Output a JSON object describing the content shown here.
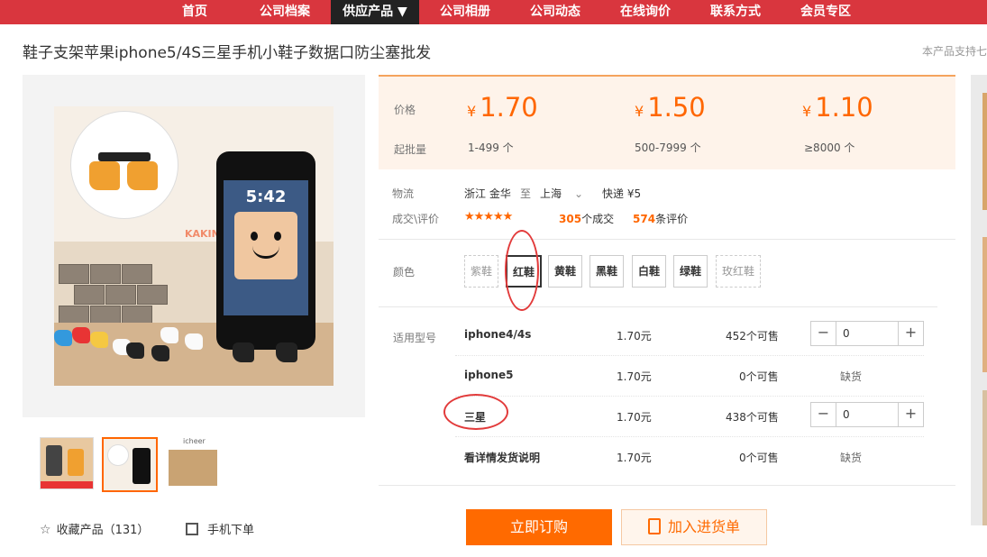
{
  "nav": {
    "items": [
      "首页",
      "公司档案",
      "供应产品 ▼",
      "公司相册",
      "公司动态",
      "在线询价",
      "联系方式",
      "会员专区"
    ],
    "active_index": 2,
    "color": "#d9363e"
  },
  "product": {
    "title": "鞋子支架苹果iphone5/4S三星手机小鞋子数据口防尘塞批发",
    "support_note": "本产品支持七"
  },
  "gallery": {
    "watermark": "KAKING",
    "phone_time": "5:42",
    "thumbnails": [
      "thumb-1",
      "thumb-2",
      "thumb-3"
    ],
    "active_thumb": 1,
    "thumb3_caption": "icheer",
    "favorite_label": "收藏产品（131）",
    "mobile_label": "手机下单"
  },
  "pricing": {
    "price_label": "价格",
    "moq_label": "起批量",
    "currency": "¥",
    "tiers": [
      {
        "price": "1.70",
        "qty": "1-499 个"
      },
      {
        "price": "1.50",
        "qty": "500-7999 个"
      },
      {
        "price": "1.10",
        "qty": "≥8000 个"
      }
    ],
    "accent": "#ff6600"
  },
  "logistics": {
    "label": "物流",
    "from": "浙江 金华",
    "to_word": "至",
    "dest": "上海",
    "ship": "快递 ¥5"
  },
  "reviews": {
    "label": "成交\\评价",
    "stars": "★★★★★",
    "deals_count": "305",
    "deals_unit": "个成交",
    "reviews_count": "574",
    "reviews_unit": "条评价",
    "rating": 4.5
  },
  "colors": {
    "label": "颜色",
    "options": [
      "紫鞋",
      "红鞋",
      "黄鞋",
      "黑鞋",
      "白鞋",
      "绿鞋",
      "玫红鞋"
    ],
    "selected_index": 1
  },
  "models": {
    "label": "适用型号",
    "rows": [
      {
        "name": "iphone4/4s",
        "price": "1.70元",
        "stock": "452个可售",
        "qty": "0",
        "status": ""
      },
      {
        "name": "iphone5",
        "price": "1.70元",
        "stock": "0个可售",
        "qty": "",
        "status": "缺货"
      },
      {
        "name": "三星",
        "price": "1.70元",
        "stock": "438个可售",
        "qty": "0",
        "status": ""
      },
      {
        "name": "看详情发货说明",
        "price": "1.70元",
        "stock": "0个可售",
        "qty": "",
        "status": "缺货"
      }
    ]
  },
  "actions": {
    "buy": "立即订购",
    "cart": "加入进货单"
  }
}
